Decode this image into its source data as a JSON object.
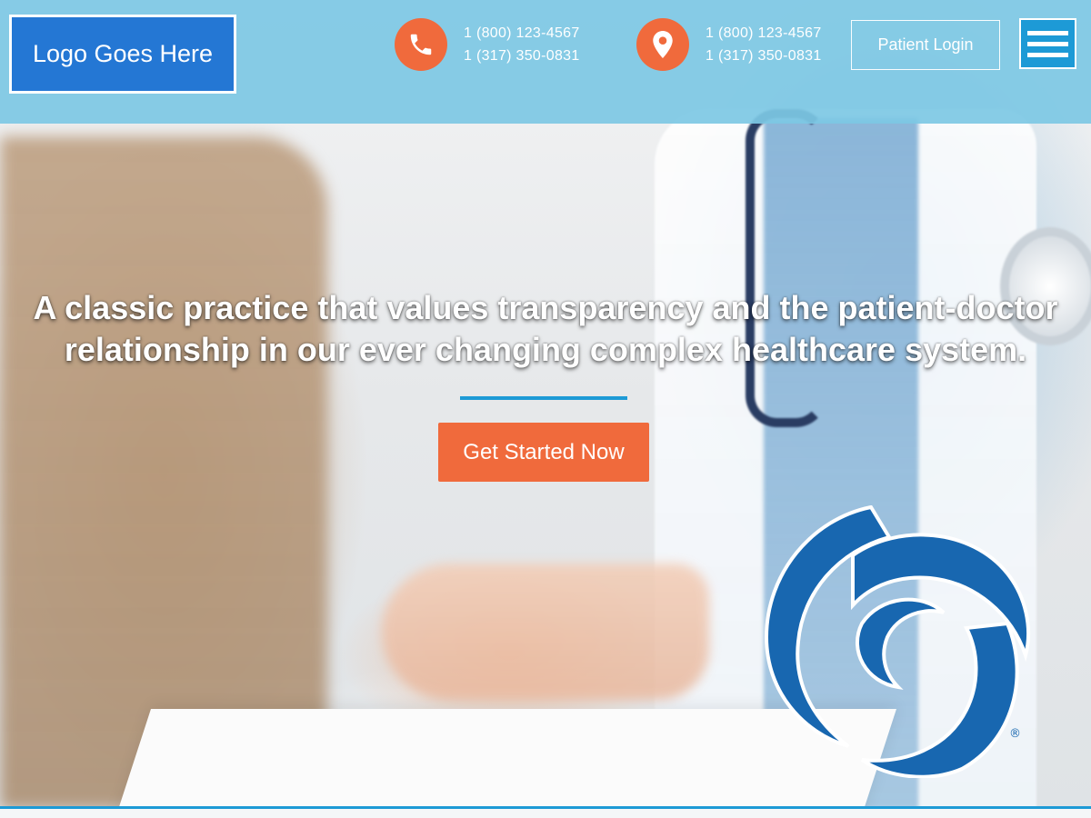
{
  "header": {
    "logo_text": "Logo Goes Here",
    "phone_contact": {
      "icon": "phone-icon",
      "line1": "1 (800) 123-4567",
      "line2": "1 (317) 350-0831"
    },
    "location_contact": {
      "icon": "location-pin-icon",
      "line1": "1 (800) 123-4567",
      "line2": "1 (317) 350-0831"
    },
    "patient_login_label": "Patient Login",
    "menu_icon": "hamburger-menu-icon"
  },
  "hero": {
    "headline_line1": "A classic practice that values transparency and the patient-doctor",
    "headline_line2": "relationship in our ever changing complex healthcare system.",
    "cta_label": "Get Started Now",
    "emblem_icon": "swirl-emblem-icon",
    "registered_mark": "®"
  },
  "colors": {
    "topbar": "#7dc8e4",
    "accent_orange": "#f06a3c",
    "accent_blue": "#1d9ad6",
    "logo_blue": "#2477d4",
    "emblem_blue": "#1867b0"
  }
}
